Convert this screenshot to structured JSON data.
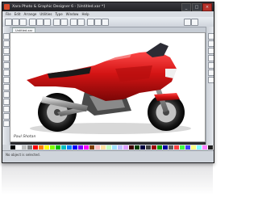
{
  "window": {
    "title": "Xara Photo & Graphic Designer 6 - [Untitled.xar *]",
    "minimize_label": "_",
    "maximize_label": "□",
    "close_label": "×"
  },
  "menubar": {
    "items": [
      "File",
      "Edit",
      "Arrange",
      "Utilities",
      "Type",
      "Window",
      "Help"
    ]
  },
  "document": {
    "tab_label": "Untitled.xar",
    "photo_credit": "Paul Shotan"
  },
  "palette": {
    "colors": [
      "#000000",
      "#ffffff",
      "#c0c0c0",
      "#808080",
      "#ff0000",
      "#ff8000",
      "#ffff00",
      "#80ff00",
      "#00c000",
      "#00c0c0",
      "#0080ff",
      "#0000ff",
      "#8000ff",
      "#ff00ff",
      "#804000",
      "#ffc0c0",
      "#ffe0a0",
      "#c0ffc0",
      "#a0e0ff",
      "#c0c0ff",
      "#e0a0ff",
      "#400000",
      "#004000",
      "#000040",
      "#404040",
      "#a00000",
      "#00a000",
      "#0000a0",
      "#606060",
      "#ff4040",
      "#40ff40",
      "#4040ff",
      "#ffff80",
      "#80ffff",
      "#ff80ff",
      "#202020"
    ]
  },
  "statusbar": {
    "text": "No object is selected."
  }
}
